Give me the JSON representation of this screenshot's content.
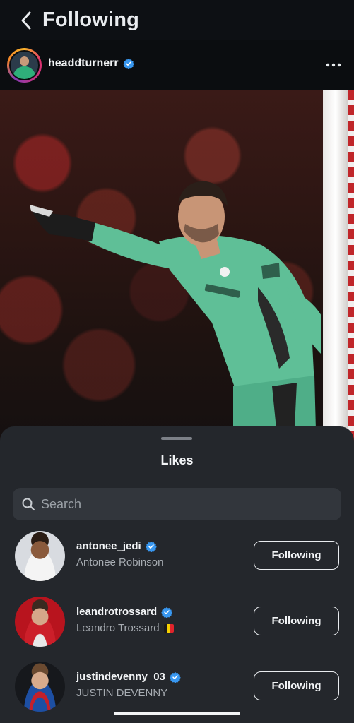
{
  "header": {
    "title": "Following"
  },
  "post": {
    "username": "headdturnerr",
    "verified": true
  },
  "likes_sheet": {
    "title": "Likes",
    "search": {
      "placeholder": "Search",
      "value": ""
    },
    "users": [
      {
        "username": "antonee_jedi",
        "full_name": "Antonee Robinson",
        "verified": true,
        "button_label": "Following"
      },
      {
        "username": "leandrotrossard",
        "full_name": "Leandro Trossard",
        "verified": true,
        "flag": "Belgium",
        "button_label": "Following"
      },
      {
        "username": "justindevenny_03",
        "full_name": "JUSTIN DEVENNY",
        "verified": true,
        "button_label": "Following"
      }
    ]
  },
  "colors": {
    "verified_blue": "#3897f0",
    "sheet_bg": "#24272c",
    "kit_green": "#5fbf97"
  },
  "icons": [
    "chevron-left-icon",
    "verified-badge-icon",
    "more-dots-icon",
    "search-icon",
    "belgium-flag-icon"
  ]
}
